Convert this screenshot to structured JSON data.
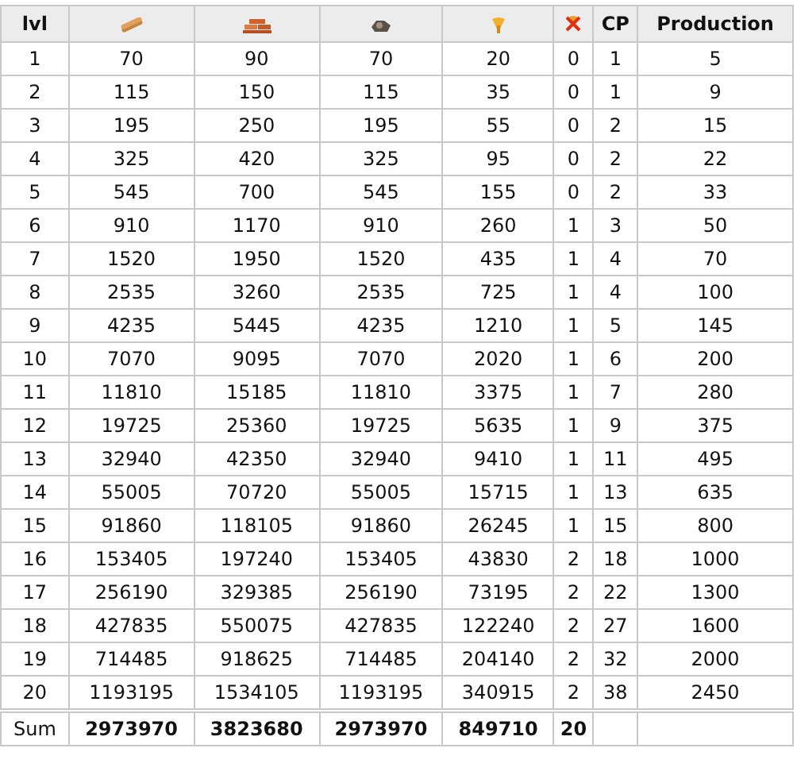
{
  "table": {
    "columns": [
      {
        "kind": "text",
        "label": "lvl"
      },
      {
        "kind": "icon"
      },
      {
        "kind": "icon"
      },
      {
        "kind": "icon"
      },
      {
        "kind": "icon"
      },
      {
        "kind": "icon"
      },
      {
        "kind": "text",
        "label": "CP"
      },
      {
        "kind": "text",
        "label": "Production"
      }
    ],
    "rows": [
      [
        "1",
        "70",
        "90",
        "70",
        "20",
        "0",
        "1",
        "5"
      ],
      [
        "2",
        "115",
        "150",
        "115",
        "35",
        "0",
        "1",
        "9"
      ],
      [
        "3",
        "195",
        "250",
        "195",
        "55",
        "0",
        "2",
        "15"
      ],
      [
        "4",
        "325",
        "420",
        "325",
        "95",
        "0",
        "2",
        "22"
      ],
      [
        "5",
        "545",
        "700",
        "545",
        "155",
        "0",
        "2",
        "33"
      ],
      [
        "6",
        "910",
        "1170",
        "910",
        "260",
        "1",
        "3",
        "50"
      ],
      [
        "7",
        "1520",
        "1950",
        "1520",
        "435",
        "1",
        "4",
        "70"
      ],
      [
        "8",
        "2535",
        "3260",
        "2535",
        "725",
        "1",
        "4",
        "100"
      ],
      [
        "9",
        "4235",
        "5445",
        "4235",
        "1210",
        "1",
        "5",
        "145"
      ],
      [
        "10",
        "7070",
        "9095",
        "7070",
        "2020",
        "1",
        "6",
        "200"
      ],
      [
        "11",
        "11810",
        "15185",
        "11810",
        "3375",
        "1",
        "7",
        "280"
      ],
      [
        "12",
        "19725",
        "25360",
        "19725",
        "5635",
        "1",
        "9",
        "375"
      ],
      [
        "13",
        "32940",
        "42350",
        "32940",
        "9410",
        "1",
        "11",
        "495"
      ],
      [
        "14",
        "55005",
        "70720",
        "55005",
        "15715",
        "1",
        "13",
        "635"
      ],
      [
        "15",
        "91860",
        "118105",
        "91860",
        "26245",
        "1",
        "15",
        "800"
      ],
      [
        "16",
        "153405",
        "197240",
        "153405",
        "43830",
        "2",
        "18",
        "1000"
      ],
      [
        "17",
        "256190",
        "329385",
        "256190",
        "73195",
        "2",
        "22",
        "1300"
      ],
      [
        "18",
        "427835",
        "550075",
        "427835",
        "122240",
        "2",
        "27",
        "1600"
      ],
      [
        "19",
        "714485",
        "918625",
        "714485",
        "204140",
        "2",
        "32",
        "2000"
      ],
      [
        "20",
        "1193195",
        "1534105",
        "1193195",
        "340915",
        "2",
        "38",
        "2450"
      ]
    ],
    "sum": [
      "Sum",
      "2973970",
      "3823680",
      "2973970",
      "849710",
      "20"
    ]
  }
}
